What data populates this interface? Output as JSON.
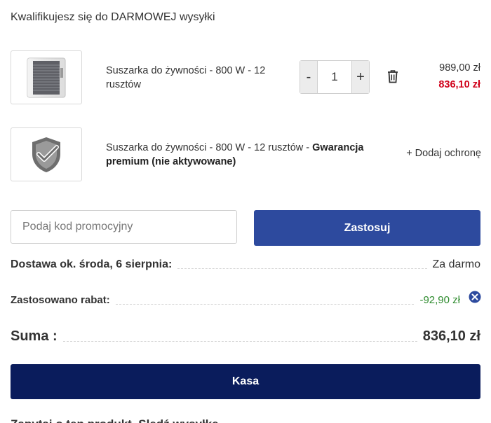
{
  "shipping": {
    "message": "Kwalifikujesz się do DARMOWEJ wysyłki"
  },
  "items": [
    {
      "name": "Suszarka do żywności - 800 W - 12 rusztów",
      "quantity": "1",
      "qty_minus": "-",
      "qty_plus": "+",
      "price_old": "989,00 zł",
      "price_new": "836,10 zł",
      "icons": {
        "product": "food-dryer-image",
        "delete": "trash-icon"
      }
    }
  ],
  "protection": {
    "name_prefix": "Suszarka do żywności - 800 W - 12 rusztów - ",
    "name_bold": "Gwarancja premium (nie aktywowane)",
    "add_label": "+ Dodaj ochronę",
    "icon": "shield-check-icon"
  },
  "promo": {
    "placeholder": "Podaj kod promocyjny",
    "apply_label": "Zastosuj"
  },
  "summary": {
    "delivery_label": "Dostawa ok. środa, 6 sierpnia:",
    "delivery_value": "Za darmo",
    "discount_label": "Zastosowano rabat:",
    "discount_value": "-92,90 zł",
    "sum_label": "Suma :",
    "sum_value": "836,10 zł"
  },
  "checkout": {
    "label": "Kasa"
  },
  "footer": {
    "cut_text": "Zapytaj o ten produkt, Sledź wysyłkę"
  },
  "colors": {
    "apply_button": "#2d4a9e",
    "checkout_button": "#0a1c5c",
    "price_new": "#d0021b",
    "discount": "#2e8b2e"
  }
}
